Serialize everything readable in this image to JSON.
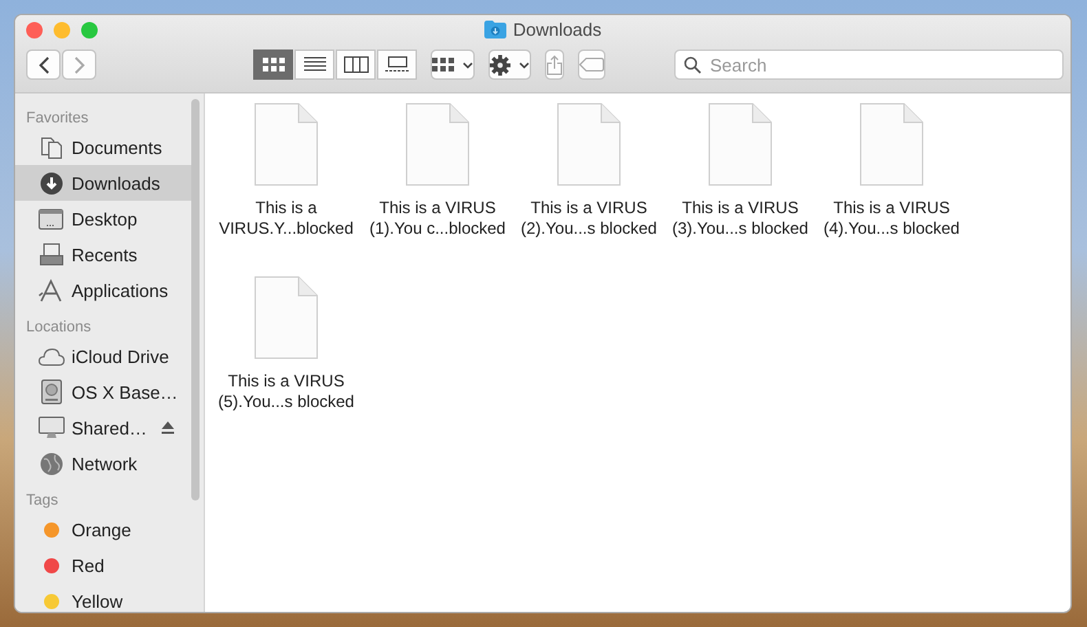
{
  "window": {
    "title": "Downloads"
  },
  "toolbar": {
    "view_modes": [
      {
        "kind": "icons",
        "selected": true
      },
      {
        "kind": "list",
        "selected": false
      },
      {
        "kind": "columns",
        "selected": false
      },
      {
        "kind": "gallery",
        "selected": false
      }
    ],
    "search": {
      "placeholder": "Search"
    }
  },
  "sidebar": {
    "sections": [
      {
        "title": "Favorites",
        "items": [
          {
            "label": "Documents",
            "kind": "documents",
            "selected": false
          },
          {
            "label": "Downloads",
            "kind": "downloads",
            "selected": true
          },
          {
            "label": "Desktop",
            "kind": "desktop",
            "selected": false
          },
          {
            "label": "Recents",
            "kind": "recents",
            "selected": false
          },
          {
            "label": "Applications",
            "kind": "applications",
            "selected": false
          }
        ]
      },
      {
        "title": "Locations",
        "items": [
          {
            "label": "iCloud Drive",
            "kind": "cloud",
            "selected": false
          },
          {
            "label": "OS X Base…",
            "kind": "disk",
            "selected": false
          },
          {
            "label": "Shared…",
            "kind": "shared",
            "selected": false,
            "eject": true
          },
          {
            "label": "Network",
            "kind": "network",
            "selected": false
          }
        ]
      },
      {
        "title": "Tags",
        "items": [
          {
            "label": "Orange",
            "kind": "tag",
            "color": "#f5962a",
            "selected": false
          },
          {
            "label": "Red",
            "kind": "tag",
            "color": "#f04848",
            "selected": false
          },
          {
            "label": "Yellow",
            "kind": "tag",
            "color": "#f7c935",
            "selected": false
          }
        ]
      }
    ]
  },
  "files": [
    {
      "name_lines": [
        "This is a",
        "VIRUS.Y...blocked"
      ]
    },
    {
      "name_lines": [
        "This is a VIRUS",
        "(1).You c...blocked"
      ]
    },
    {
      "name_lines": [
        "This is a VIRUS",
        "(2).You...s blocked"
      ]
    },
    {
      "name_lines": [
        "This is a VIRUS",
        "(3).You...s blocked"
      ]
    },
    {
      "name_lines": [
        "This is a VIRUS",
        "(4).You...s blocked"
      ]
    },
    {
      "name_lines": [
        "This is a VIRUS",
        "(5).You...s blocked"
      ]
    }
  ]
}
